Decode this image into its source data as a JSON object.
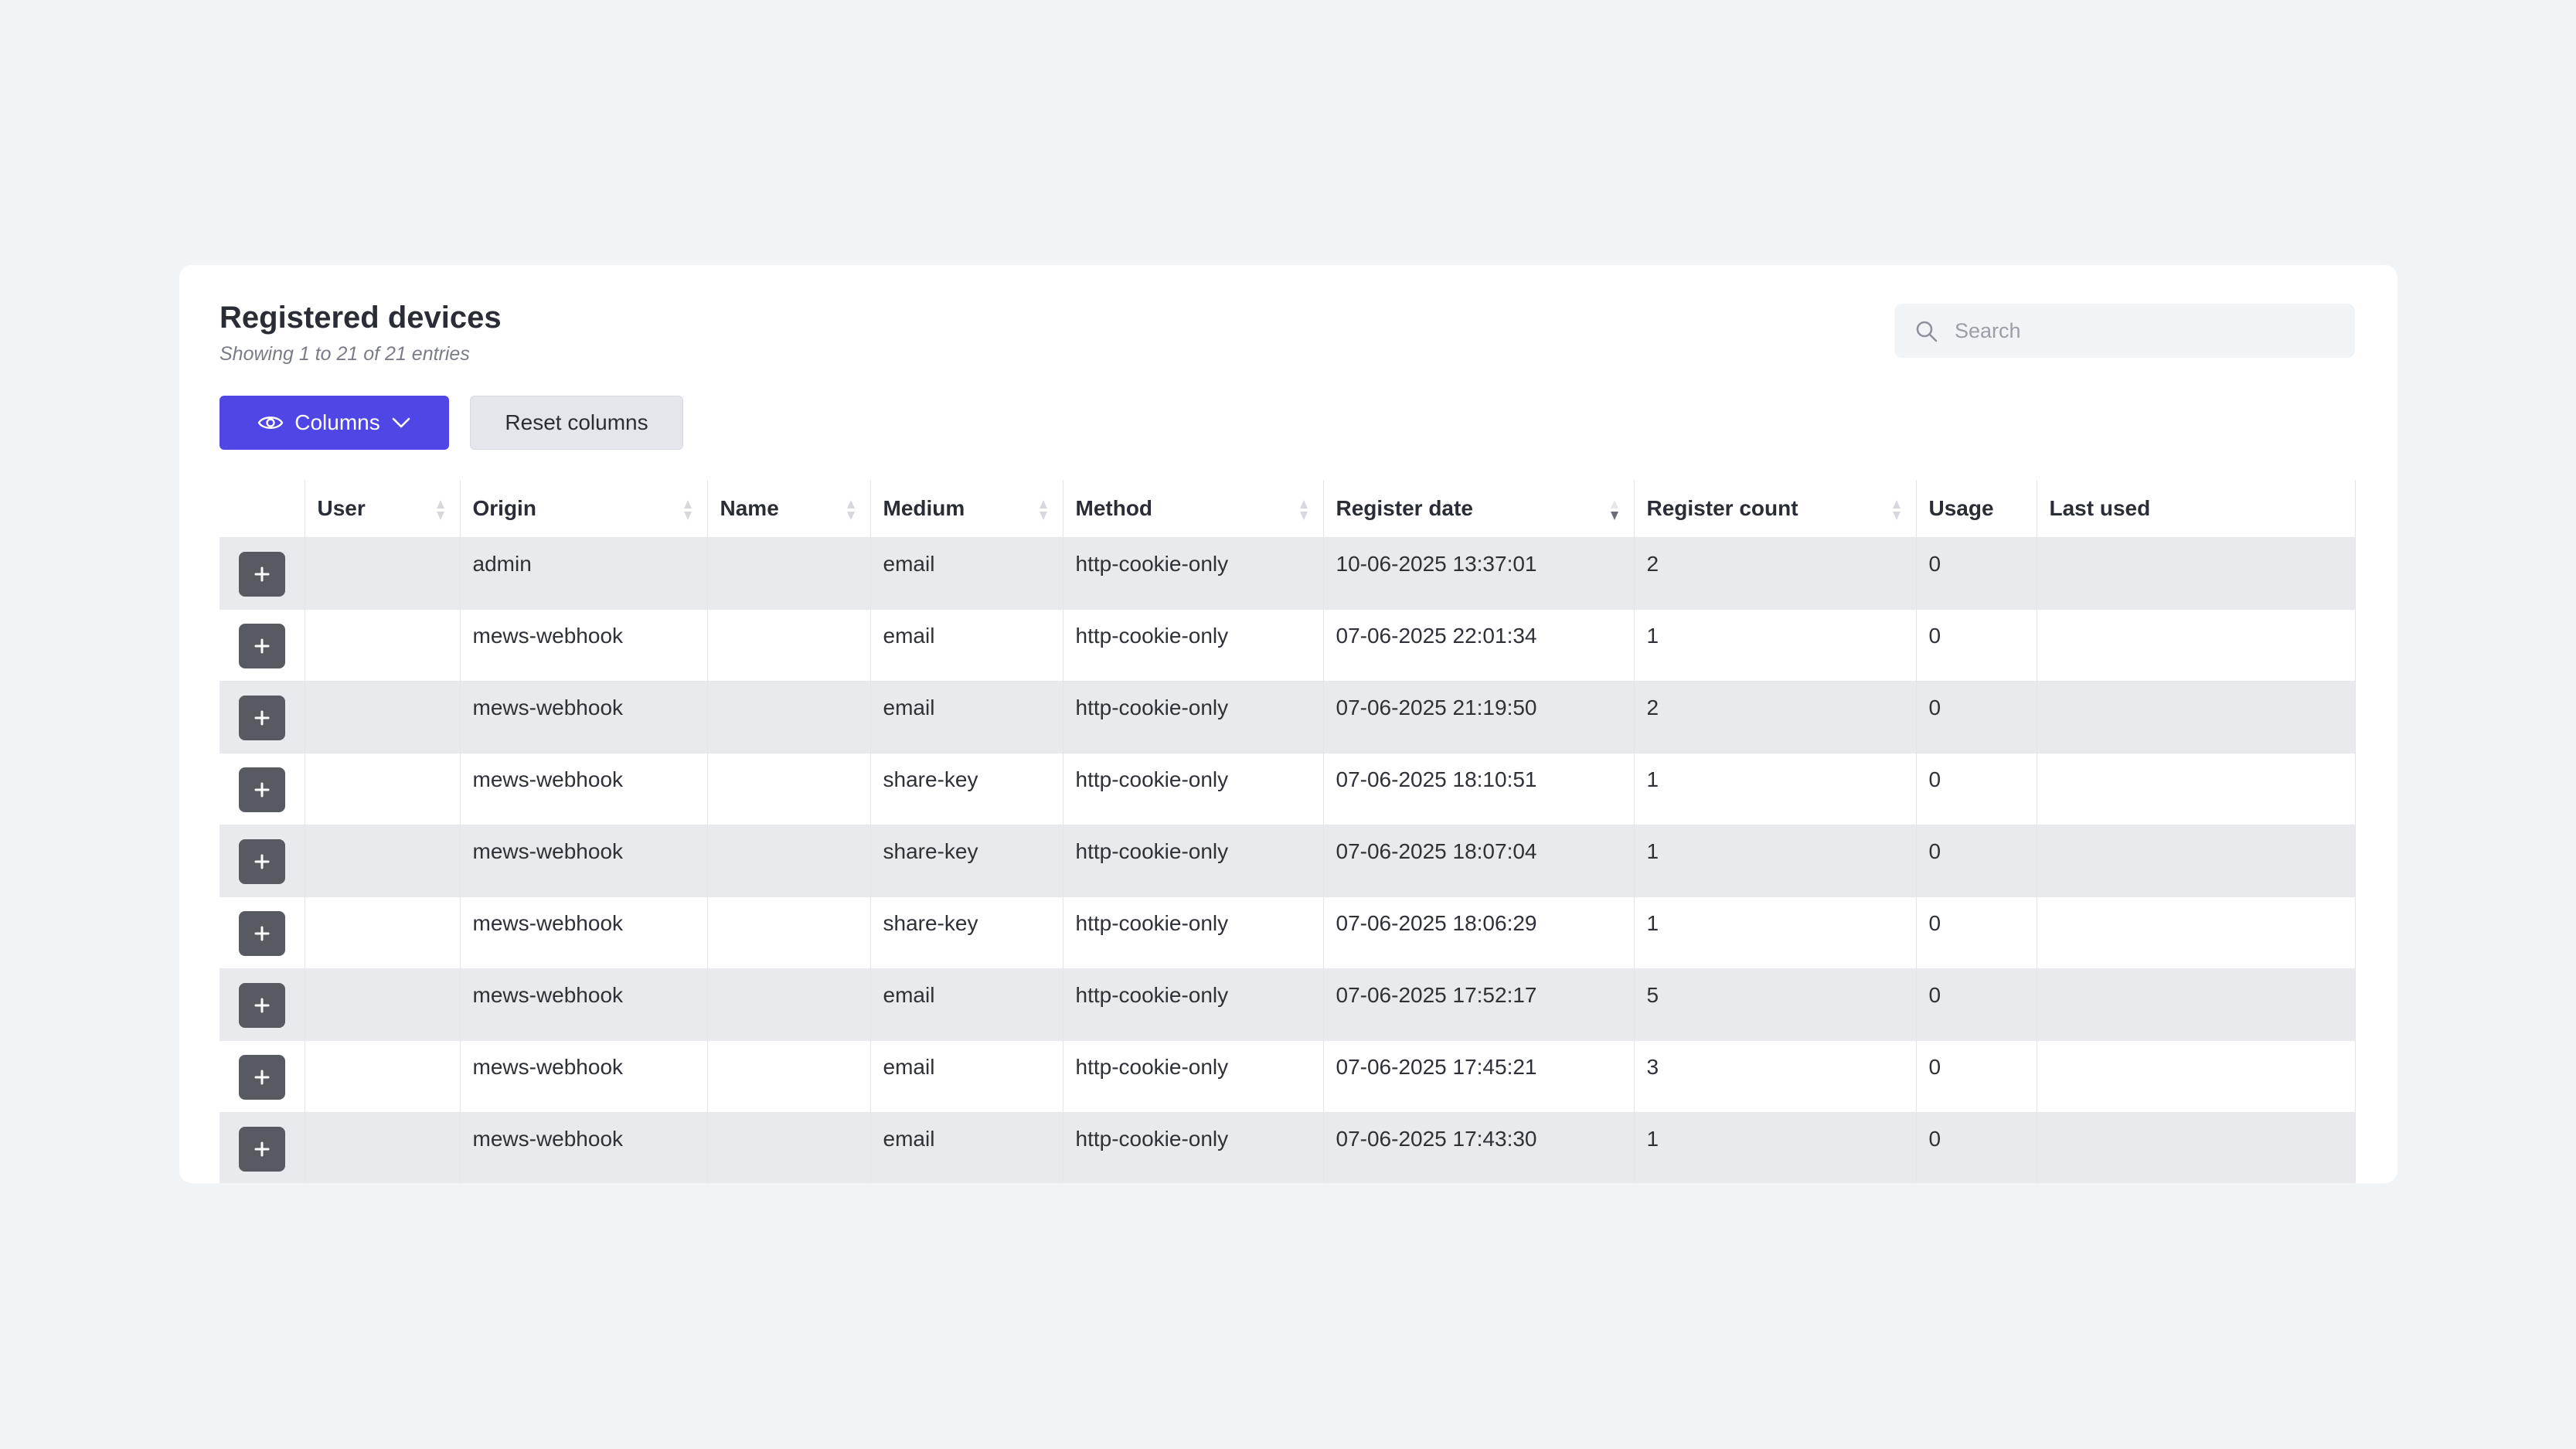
{
  "header": {
    "title": "Registered devices",
    "subtitle": "Showing 1 to 21 of 21 entries"
  },
  "search": {
    "placeholder": "Search",
    "icon": "search-icon"
  },
  "toolbar": {
    "columns_label": "Columns",
    "reset_label": "Reset columns",
    "accent": "#4f46e5"
  },
  "table": {
    "columns": [
      "User",
      "Origin",
      "Name",
      "Medium",
      "Method",
      "Register date",
      "Register count",
      "Usage",
      "Last used"
    ],
    "sort": {
      "column": "Register date",
      "direction": "descending"
    },
    "rows": [
      {
        "user": "",
        "origin": "admin",
        "name": "",
        "medium": "email",
        "method": "http-cookie-only",
        "register_date": "10-06-2025 13:37:01",
        "register_count": "2",
        "usage": "0",
        "last_used": ""
      },
      {
        "user": "",
        "origin": "mews-webhook",
        "name": "",
        "medium": "email",
        "method": "http-cookie-only",
        "register_date": "07-06-2025 22:01:34",
        "register_count": "1",
        "usage": "0",
        "last_used": ""
      },
      {
        "user": "",
        "origin": "mews-webhook",
        "name": "",
        "medium": "email",
        "method": "http-cookie-only",
        "register_date": "07-06-2025 21:19:50",
        "register_count": "2",
        "usage": "0",
        "last_used": ""
      },
      {
        "user": "",
        "origin": "mews-webhook",
        "name": "",
        "medium": "share-key",
        "method": "http-cookie-only",
        "register_date": "07-06-2025 18:10:51",
        "register_count": "1",
        "usage": "0",
        "last_used": ""
      },
      {
        "user": "",
        "origin": "mews-webhook",
        "name": "",
        "medium": "share-key",
        "method": "http-cookie-only",
        "register_date": "07-06-2025 18:07:04",
        "register_count": "1",
        "usage": "0",
        "last_used": ""
      },
      {
        "user": "",
        "origin": "mews-webhook",
        "name": "",
        "medium": "share-key",
        "method": "http-cookie-only",
        "register_date": "07-06-2025 18:06:29",
        "register_count": "1",
        "usage": "0",
        "last_used": ""
      },
      {
        "user": "",
        "origin": "mews-webhook",
        "name": "",
        "medium": "email",
        "method": "http-cookie-only",
        "register_date": "07-06-2025 17:52:17",
        "register_count": "5",
        "usage": "0",
        "last_used": ""
      },
      {
        "user": "",
        "origin": "mews-webhook",
        "name": "",
        "medium": "email",
        "method": "http-cookie-only",
        "register_date": "07-06-2025 17:45:21",
        "register_count": "3",
        "usage": "0",
        "last_used": ""
      },
      {
        "user": "",
        "origin": "mews-webhook",
        "name": "",
        "medium": "email",
        "method": "http-cookie-only",
        "register_date": "07-06-2025 17:43:30",
        "register_count": "1",
        "usage": "0",
        "last_used": ""
      }
    ]
  }
}
